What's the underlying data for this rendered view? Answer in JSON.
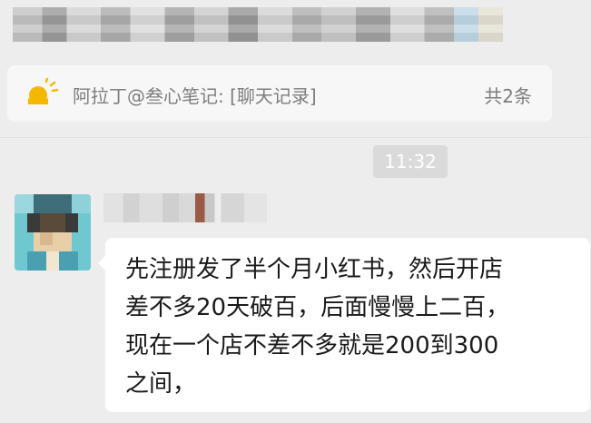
{
  "pinned": {
    "text": "阿拉丁@叁心笔记: [聊天记录]",
    "count": "共2条",
    "icon": "sun-icon",
    "accent": "#f5b800"
  },
  "timestamp": "11:32",
  "message": {
    "text": "先注册发了半个月小红书，然后开店\n差不多20天破百，后面慢慢上二百，\n现在一个店不差不多就是200到300\n之间，"
  },
  "colors": {
    "background": "#ededed",
    "bubble": "#ffffff",
    "muted_text": "#7d7d7d"
  }
}
